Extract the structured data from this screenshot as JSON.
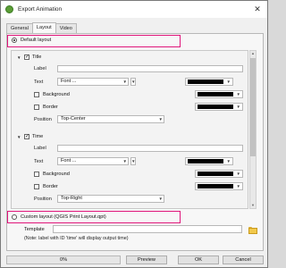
{
  "window": {
    "title": "Export Animation",
    "close_glyph": "✕",
    "icon": "qgis-logo-icon"
  },
  "tabs": [
    {
      "label": "General",
      "active": false
    },
    {
      "label": "Layout",
      "active": true
    },
    {
      "label": "Video",
      "active": false
    }
  ],
  "default_layout": {
    "label": "Default layout",
    "selected": true
  },
  "title_group": {
    "header": "Title",
    "checked": true,
    "label_field": {
      "label": "Label",
      "value": ""
    },
    "text": {
      "label": "Text",
      "font_button": "Font ...",
      "color": "#000000"
    },
    "background": {
      "label": "Background",
      "checked": false,
      "color": "#000000"
    },
    "border": {
      "label": "Border",
      "checked": false,
      "color": "#000000"
    },
    "position": {
      "label": "Position",
      "value": "Top-Center"
    }
  },
  "time_group": {
    "header": "Time",
    "checked": true,
    "label_field": {
      "label": "Label",
      "value": ""
    },
    "text": {
      "label": "Text",
      "font_button": "Font ...",
      "color": "#000000"
    },
    "background": {
      "label": "Background",
      "checked": false,
      "color": "#000000"
    },
    "border": {
      "label": "Border",
      "checked": false,
      "color": "#000000"
    },
    "position": {
      "label": "Position",
      "value": "Top-Right"
    }
  },
  "custom_layout": {
    "label": "Custom layout (QGIS Print Layout.qpt)",
    "selected": false
  },
  "template": {
    "label": "Template",
    "value": "",
    "note": "(Note: label with ID 'time' will display output time)"
  },
  "bottom": {
    "progress": "0%",
    "progress_value": 0,
    "preview": "Preview",
    "ok": "OK",
    "cancel": "Cancel"
  },
  "colors": {
    "highlight": "#e0157a",
    "swatch": "#000000"
  }
}
